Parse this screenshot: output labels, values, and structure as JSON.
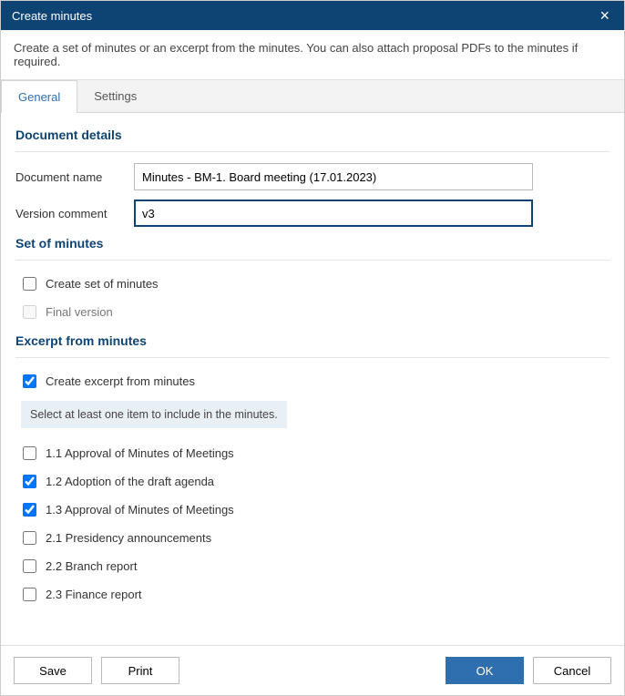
{
  "titlebar": {
    "title": "Create minutes"
  },
  "description": "Create a set of minutes or an excerpt from the minutes. You can also attach proposal PDFs to the minutes if required.",
  "tabs": {
    "general": "General",
    "settings": "Settings"
  },
  "sections": {
    "document_details": "Document details",
    "set_of_minutes": "Set of minutes",
    "excerpt": "Excerpt from minutes"
  },
  "fields": {
    "document_name": {
      "label": "Document name",
      "value": "Minutes - BM-1. Board meeting (17.01.2023)"
    },
    "version_comment": {
      "label": "Version comment",
      "value": "v3"
    }
  },
  "checkboxes": {
    "create_set": {
      "label": "Create set of minutes",
      "checked": false
    },
    "final_version": {
      "label": "Final version",
      "checked": false
    },
    "create_excerpt": {
      "label": "Create excerpt from minutes",
      "checked": true
    }
  },
  "excerpt_info": "Select at least one item to include in the minutes.",
  "excerpt_items": [
    {
      "label": "1.1 Approval of Minutes of Meetings",
      "checked": false
    },
    {
      "label": "1.2 Adoption of the draft agenda",
      "checked": true
    },
    {
      "label": "1.3 Approval of Minutes of Meetings",
      "checked": true
    },
    {
      "label": "2.1 Presidency announcements",
      "checked": false
    },
    {
      "label": "2.2 Branch report",
      "checked": false
    },
    {
      "label": "2.3 Finance report",
      "checked": false
    }
  ],
  "buttons": {
    "save": "Save",
    "print": "Print",
    "ok": "OK",
    "cancel": "Cancel"
  }
}
